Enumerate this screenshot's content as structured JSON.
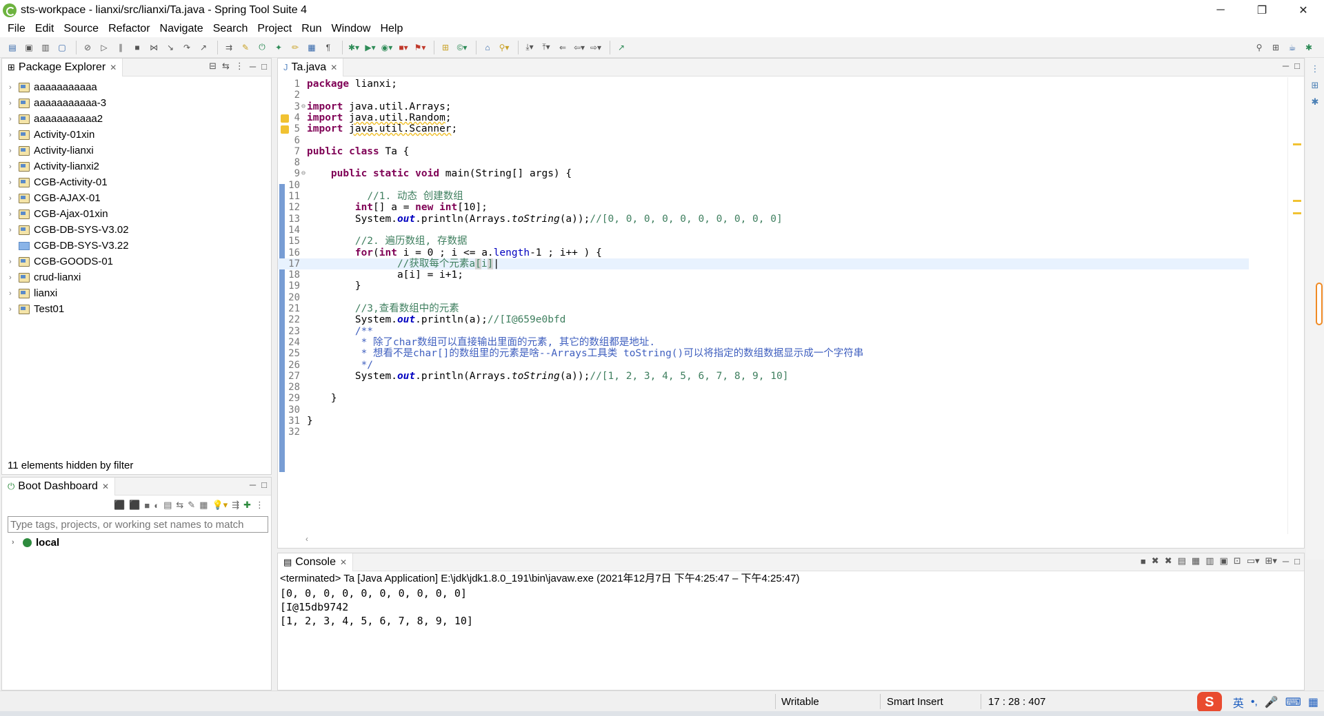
{
  "window": {
    "title": "sts-workpace - lianxi/src/lianxi/Ta.java - Spring Tool Suite 4",
    "minimize": "─",
    "restore": "❐",
    "close": "✕"
  },
  "menu": [
    "File",
    "Edit",
    "Source",
    "Refactor",
    "Navigate",
    "Search",
    "Project",
    "Run",
    "Window",
    "Help"
  ],
  "package_explorer": {
    "title": "Package Explorer",
    "projects": [
      {
        "name": "aaaaaaaaaaa",
        "type": "project"
      },
      {
        "name": "aaaaaaaaaaa-3",
        "type": "project"
      },
      {
        "name": "aaaaaaaaaaa2",
        "type": "project"
      },
      {
        "name": "Activity-01xin",
        "type": "project"
      },
      {
        "name": "Activity-lianxi",
        "type": "project"
      },
      {
        "name": "Activity-lianxi2",
        "type": "project"
      },
      {
        "name": "CGB-Activity-01",
        "type": "project"
      },
      {
        "name": "CGB-AJAX-01",
        "type": "project"
      },
      {
        "name": "CGB-Ajax-01xin",
        "type": "project"
      },
      {
        "name": "CGB-DB-SYS-V3.02",
        "type": "project"
      },
      {
        "name": "CGB-DB-SYS-V3.22",
        "type": "folder"
      },
      {
        "name": "CGB-GOODS-01",
        "type": "project"
      },
      {
        "name": "crud-lianxi",
        "type": "project"
      },
      {
        "name": "lianxi",
        "type": "project"
      },
      {
        "name": "Test01",
        "type": "project"
      }
    ],
    "filter_note": "11 elements hidden by filter"
  },
  "boot_dashboard": {
    "title": "Boot Dashboard",
    "search_placeholder": "Type tags, projects, or working set names to match",
    "local": "local"
  },
  "editor": {
    "tab": "Ta.java",
    "lines": [
      {
        "n": "1",
        "html": "<span class='kw'>package</span> lianxi;"
      },
      {
        "n": "2",
        "html": ""
      },
      {
        "n": "3",
        "html": "<span class='kw'>import</span> java.util.Arrays;",
        "fold": true
      },
      {
        "n": "4",
        "html": "<span class='kw'>import</span> <span class='ul'>java.util.Random</span>;",
        "warn": true
      },
      {
        "n": "5",
        "html": "<span class='kw'>import</span> <span class='ul'>java.util.Scanner</span>;",
        "warn": true
      },
      {
        "n": "6",
        "html": ""
      },
      {
        "n": "7",
        "html": "<span class='kw'>public class</span> Ta {"
      },
      {
        "n": "8",
        "html": ""
      },
      {
        "n": "9",
        "html": "    <span class='kw'>public static void</span> main(String[] args) {",
        "fold": true
      },
      {
        "n": "10",
        "html": ""
      },
      {
        "n": "11",
        "html": "          <span class='cm'>//1. 动态 创建数组</span>"
      },
      {
        "n": "12",
        "html": "        <span class='kw'>int</span>[] a = <span class='kw'>new int</span>[10];"
      },
      {
        "n": "13",
        "html": "        System.<span class='st'>out</span>.println(Arrays.<span class='it'>toString</span>(a));<span class='cm'>//[0, 0, 0, 0, 0, 0, 0, 0, 0, 0]</span>"
      },
      {
        "n": "14",
        "html": ""
      },
      {
        "n": "15",
        "html": "        <span class='cm'>//2. 遍历数组, 存数据</span>"
      },
      {
        "n": "16",
        "html": "        <span class='kw'>for</span>(<span class='kw'>int</span> i = 0 ; i &lt;= a.<span class='fi'>length</span>-1 ; i++ ) {"
      },
      {
        "n": "17",
        "html": "               <span class='cm'>//获取每个元素a<span class='hl'>[</span>i<span class='hl'>]</span></span>|",
        "current": true
      },
      {
        "n": "18",
        "html": "               a[i] = i+1;"
      },
      {
        "n": "19",
        "html": "        }"
      },
      {
        "n": "20",
        "html": ""
      },
      {
        "n": "21",
        "html": "        <span class='cm'>//3,查看数组中的元素</span>"
      },
      {
        "n": "22",
        "html": "        System.<span class='st'>out</span>.println(a);<span class='cm'>//[I@659e0bfd</span>"
      },
      {
        "n": "23",
        "html": "        <span class='jd'>/**</span>"
      },
      {
        "n": "24",
        "html": "<span class='jd'>         * 除了char数组可以直接输出里面的元素, 其它的数组都是地址.</span>"
      },
      {
        "n": "25",
        "html": "<span class='jd'>         * 想看不是char[]的数组里的元素是啥--Arrays工具类 toString()可以将指定的数组数据显示成一个字符串</span>"
      },
      {
        "n": "26",
        "html": "<span class='jd'>         */</span>"
      },
      {
        "n": "27",
        "html": "        System.<span class='st'>out</span>.println(Arrays.<span class='it'>toString</span>(a));<span class='cm'>//[1, 2, 3, 4, 5, 6, 7, 8, 9, 10]</span>"
      },
      {
        "n": "28",
        "html": ""
      },
      {
        "n": "29",
        "html": "    }"
      },
      {
        "n": "30",
        "html": ""
      },
      {
        "n": "31",
        "html": "}"
      },
      {
        "n": "32",
        "html": ""
      }
    ]
  },
  "console": {
    "title": "Console",
    "terminated": "<terminated> Ta [Java Application] E:\\jdk\\jdk1.8.0_191\\bin\\javaw.exe  (2021年12月7日 下午4:25:47 – 下午4:25:47)",
    "output": [
      "[0, 0, 0, 0, 0, 0, 0, 0, 0, 0]",
      "[I@15db9742",
      "[1, 2, 3, 4, 5, 6, 7, 8, 9, 10]"
    ]
  },
  "status": {
    "writable": "Writable",
    "insert_mode": "Smart Insert",
    "position": "17 : 28 : 407"
  },
  "ime": {
    "logo": "S",
    "lang": "英"
  }
}
